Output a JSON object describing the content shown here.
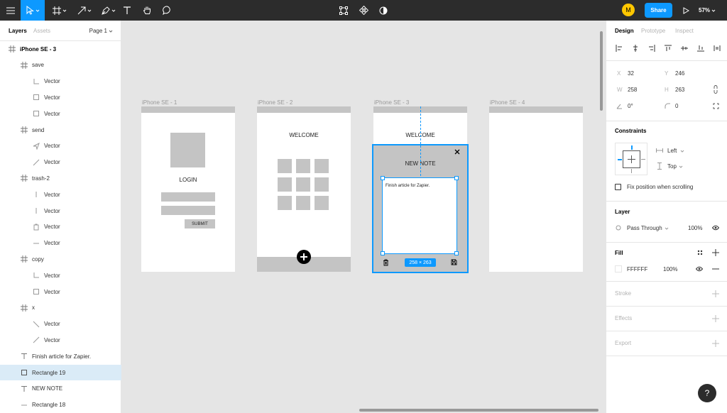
{
  "toolbar": {
    "avatar_initial": "M",
    "share_label": "Share",
    "zoom": "57%"
  },
  "left_panel": {
    "tabs": [
      "Layers",
      "Assets"
    ],
    "page_selector": "Page 1",
    "layers": [
      {
        "label": "iPhone SE - 3",
        "icon": "frame-icon"
      },
      {
        "label": "save",
        "icon": "frame-icon"
      },
      {
        "label": "Vector",
        "icon": "corner-vector-icon"
      },
      {
        "label": "Vector",
        "icon": "square-vector-icon"
      },
      {
        "label": "Vector",
        "icon": "square-vector-icon"
      },
      {
        "label": "send",
        "icon": "frame-icon"
      },
      {
        "label": "Vector",
        "icon": "send-vector-icon"
      },
      {
        "label": "Vector",
        "icon": "line-vector-icon"
      },
      {
        "label": "trash-2",
        "icon": "frame-icon"
      },
      {
        "label": "Vector",
        "icon": "vertical-line-icon"
      },
      {
        "label": "Vector",
        "icon": "vertical-line-icon"
      },
      {
        "label": "Vector",
        "icon": "trash-vector-icon"
      },
      {
        "label": "Vector",
        "icon": "horizontal-line-icon"
      },
      {
        "label": "copy",
        "icon": "frame-icon"
      },
      {
        "label": "Vector",
        "icon": "corner-vector-icon"
      },
      {
        "label": "Vector",
        "icon": "square-vector-icon"
      },
      {
        "label": "x",
        "icon": "frame-icon"
      },
      {
        "label": "Vector",
        "icon": "diagonal-line-icon"
      },
      {
        "label": "Vector",
        "icon": "line-vector-icon"
      },
      {
        "label": "Finish article for Zapier.",
        "icon": "text-icon"
      },
      {
        "label": "Rectangle 19",
        "icon": "rectangle-icon"
      },
      {
        "label": "NEW NOTE",
        "icon": "text-icon"
      },
      {
        "label": "Rectangle 18",
        "icon": "horizontal-line-icon"
      }
    ]
  },
  "canvas": {
    "frames": [
      {
        "label": "iPhone SE - 1"
      },
      {
        "label": "iPhone SE - 2"
      },
      {
        "label": "iPhone SE - 3"
      },
      {
        "label": "iPhone SE - 4"
      }
    ],
    "login_text": "LOGIN",
    "submit_text": "SUBMIT",
    "welcome_text_2": "WELCOME",
    "welcome_text_3": "WELCOME",
    "new_note_text": "NEW NOTE",
    "note_body": "Finish article for Zapier.",
    "dimension_badge": "258 × 263"
  },
  "right_panel": {
    "tabs": [
      "Design",
      "Prototype",
      "Inspect"
    ],
    "x_label": "X",
    "x_value": "32",
    "y_label": "Y",
    "y_value": "246",
    "w_label": "W",
    "w_value": "258",
    "h_label": "H",
    "h_value": "263",
    "rotation": "0°",
    "radius": "0",
    "constraints_title": "Constraints",
    "constraint_h": "Left",
    "constraint_v": "Top",
    "fix_position": "Fix position when scrolling",
    "layer_title": "Layer",
    "blend_mode": "Pass Through",
    "layer_opacity": "100%",
    "fill_title": "Fill",
    "fill_hex": "FFFFFF",
    "fill_opacity": "100%",
    "stroke_title": "Stroke",
    "effects_title": "Effects",
    "export_title": "Export"
  },
  "help_label": "?",
  "colors": {
    "toolbar_bg": "#2c2c2c",
    "accent": "#0d99ff",
    "canvas_bg": "#e5e5e5",
    "wireframe_gray": "#c4c4c4",
    "avatar": "#ffc700"
  }
}
